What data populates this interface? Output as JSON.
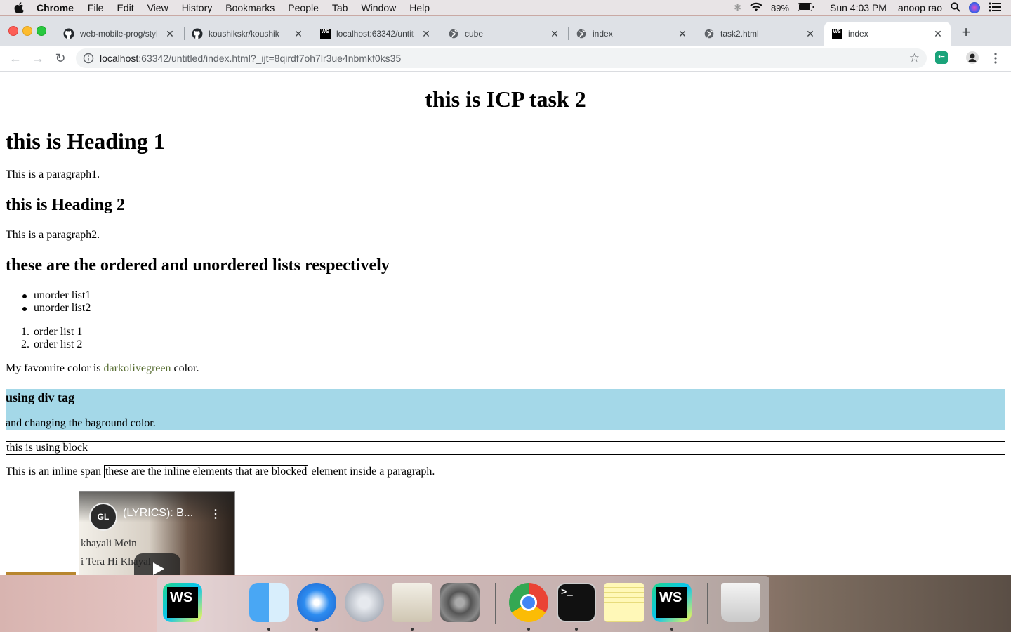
{
  "menubar": {
    "app_name": "Chrome",
    "items": [
      "File",
      "Edit",
      "View",
      "History",
      "Bookmarks",
      "People",
      "Tab",
      "Window",
      "Help"
    ],
    "battery": "89%",
    "clock": "Sun 4:03 PM",
    "user": "anoop rao"
  },
  "tabs": [
    {
      "title": "web-mobile-prog/styl",
      "icon": "github-icon"
    },
    {
      "title": "koushikskr/koushik",
      "icon": "github-icon"
    },
    {
      "title": "localhost:63342/untit",
      "icon": "webstorm-icon"
    },
    {
      "title": "cube",
      "icon": "globe-icon"
    },
    {
      "title": "index",
      "icon": "globe-icon"
    },
    {
      "title": "task2.html",
      "icon": "globe-icon"
    },
    {
      "title": "index",
      "icon": "webstorm-icon",
      "active": true
    }
  ],
  "toolbar": {
    "url_host": "localhost",
    "url_rest": ":63342/untitled/index.html?_ijt=8qirdf7oh7lr3ue4nbmkf0ks35"
  },
  "page": {
    "title": "this is ICP task 2",
    "heading1": "this is Heading 1",
    "paragraph1": "This is a paragraph1.",
    "heading2": "this is Heading 2",
    "paragraph2": "This is a paragraph2.",
    "lists_heading": "these are the ordered and unordered lists respectively",
    "unordered": [
      "unorder list1",
      "unorder list2"
    ],
    "ordered": [
      "order list 1",
      "order list 2"
    ],
    "favourite_prefix": "My favourite color is ",
    "favourite_color_name": "darkolivegreen",
    "favourite_suffix": " color.",
    "favourite_color_hex": "#556b2f",
    "div_heading": "using div tag",
    "div_paragraph": "and changing the baground color.",
    "div_background": "#a4d8e8",
    "block_text": "this is using block",
    "inline_prefix": "This is an inline span ",
    "inline_span": "these are the inline elements that are blocked",
    "inline_suffix": " element inside a paragraph.",
    "video": {
      "title": "(LYRICS): B...",
      "channel_badge": "GL",
      "lyric_line1": "khayali Mein",
      "lyric_line2": "i Tera Hi Khayal"
    }
  },
  "dock": [
    "webstorm",
    "finder",
    "safari",
    "launchpad",
    "mail",
    "system-preferences",
    "chrome",
    "terminal",
    "notes",
    "webstorm",
    "trash"
  ]
}
